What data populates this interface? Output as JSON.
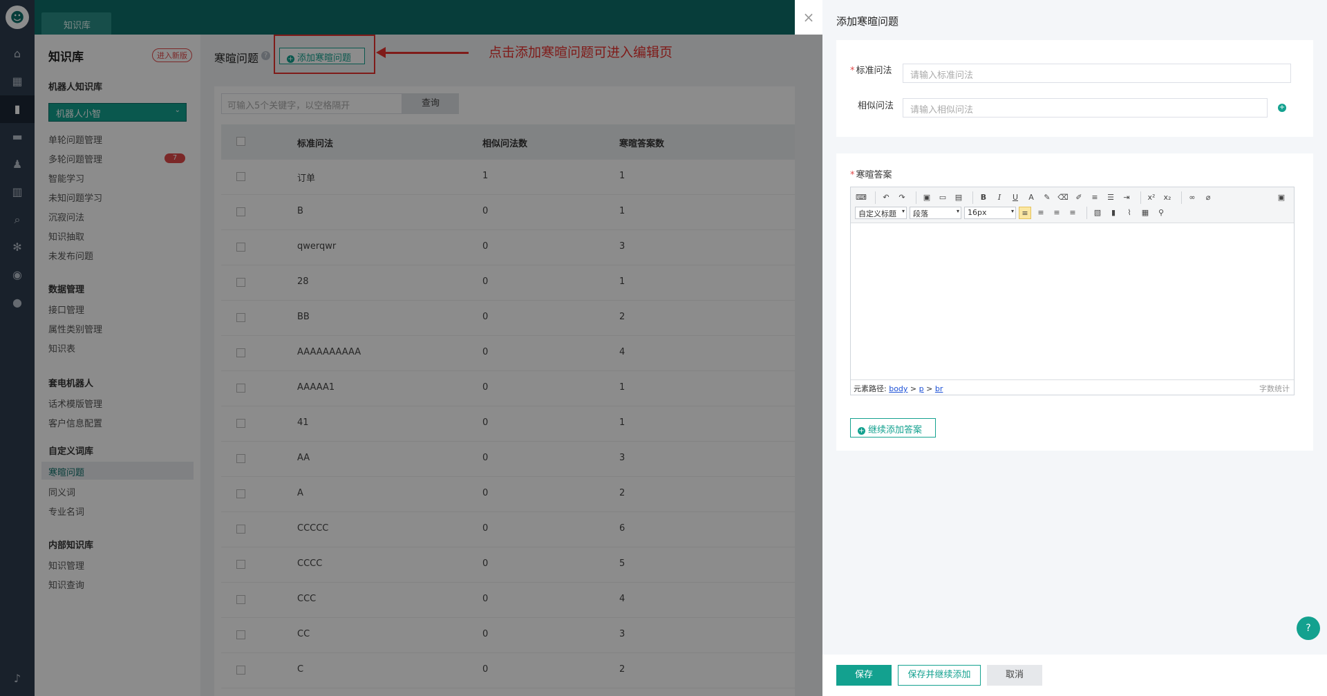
{
  "topbar": {
    "tab_label": "知识库"
  },
  "rail": {
    "icons": [
      "home-icon",
      "apps-icon",
      "book-icon",
      "chat-icon",
      "users-icon",
      "chart-icon",
      "search-icon",
      "settings-icon",
      "target-icon",
      "user-circle-icon",
      "bell-icon"
    ]
  },
  "nav": {
    "title": "知识库",
    "new_badge": "进入新版",
    "groups": {
      "robot_kb": "机器人知识库",
      "data": "数据管理",
      "telerobot": "套电机器人",
      "custom_dict": "自定义词库",
      "internal": "内部知识库"
    },
    "robot_select": "机器人小智",
    "items": {
      "single": "单轮问题管理",
      "multi": "多轮问题管理",
      "multi_count": "7",
      "smart": "智能学习",
      "unknown": "未知问题学习",
      "silent": "沉寂问法",
      "extract": "知识抽取",
      "unpublished": "未发布问题",
      "api": "接口管理",
      "attr": "属性类别管理",
      "table": "知识表",
      "script": "话术模版管理",
      "customer": "客户信息配置",
      "greeting": "寒暄问题",
      "synonym": "同义词",
      "term": "专业名词",
      "kmanage": "知识管理",
      "kquery": "知识查询"
    }
  },
  "main": {
    "title": "寒暄问题",
    "help": "?",
    "add_button": "添加寒暄问题",
    "annotation": "点击添加寒暄问题可进入编辑页",
    "search_placeholder": "可输入5个关键字，以空格隔开",
    "query_button": "查询",
    "columns": [
      "标准问法",
      "相似问法数",
      "寒暄答案数"
    ],
    "rows": [
      [
        "订单",
        "1",
        "1"
      ],
      [
        "B",
        "0",
        "1"
      ],
      [
        "qwerqwr",
        "0",
        "3"
      ],
      [
        "28",
        "0",
        "1"
      ],
      [
        "BB",
        "0",
        "2"
      ],
      [
        "AAAAAAAAAA",
        "0",
        "4"
      ],
      [
        "AAAAA1",
        "0",
        "1"
      ],
      [
        "41",
        "0",
        "1"
      ],
      [
        "AA",
        "0",
        "3"
      ],
      [
        "A",
        "0",
        "2"
      ],
      [
        "CCCCC",
        "0",
        "6"
      ],
      [
        "CCCC",
        "0",
        "5"
      ],
      [
        "CCC",
        "0",
        "4"
      ],
      [
        "CC",
        "0",
        "3"
      ],
      [
        "C",
        "0",
        "2"
      ]
    ]
  },
  "drawer": {
    "title": "添加寒暄问题",
    "close": "×",
    "std_label": "标准问法",
    "std_placeholder": "请输入标准问法",
    "sim_label": "相似问法",
    "sim_placeholder": "请输入相似问法",
    "answer_label": "寒暄答案",
    "required_mark": "*",
    "editor": {
      "heading_select": "自定义标题",
      "para_select": "段落",
      "size_select": "16px",
      "path_label": "元素路径:",
      "path": [
        "body",
        "p",
        "br"
      ],
      "wordcount": "字数统计"
    },
    "more_answer": "继续添加答案",
    "save": "保存",
    "save_more": "保存并继续添加",
    "cancel": "取消",
    "help_float": "?"
  },
  "colors": {
    "accent": "#13a18f",
    "topbar": "#0e6f6a",
    "rail": "#2e3c4f",
    "annotation": "#e8322e"
  }
}
